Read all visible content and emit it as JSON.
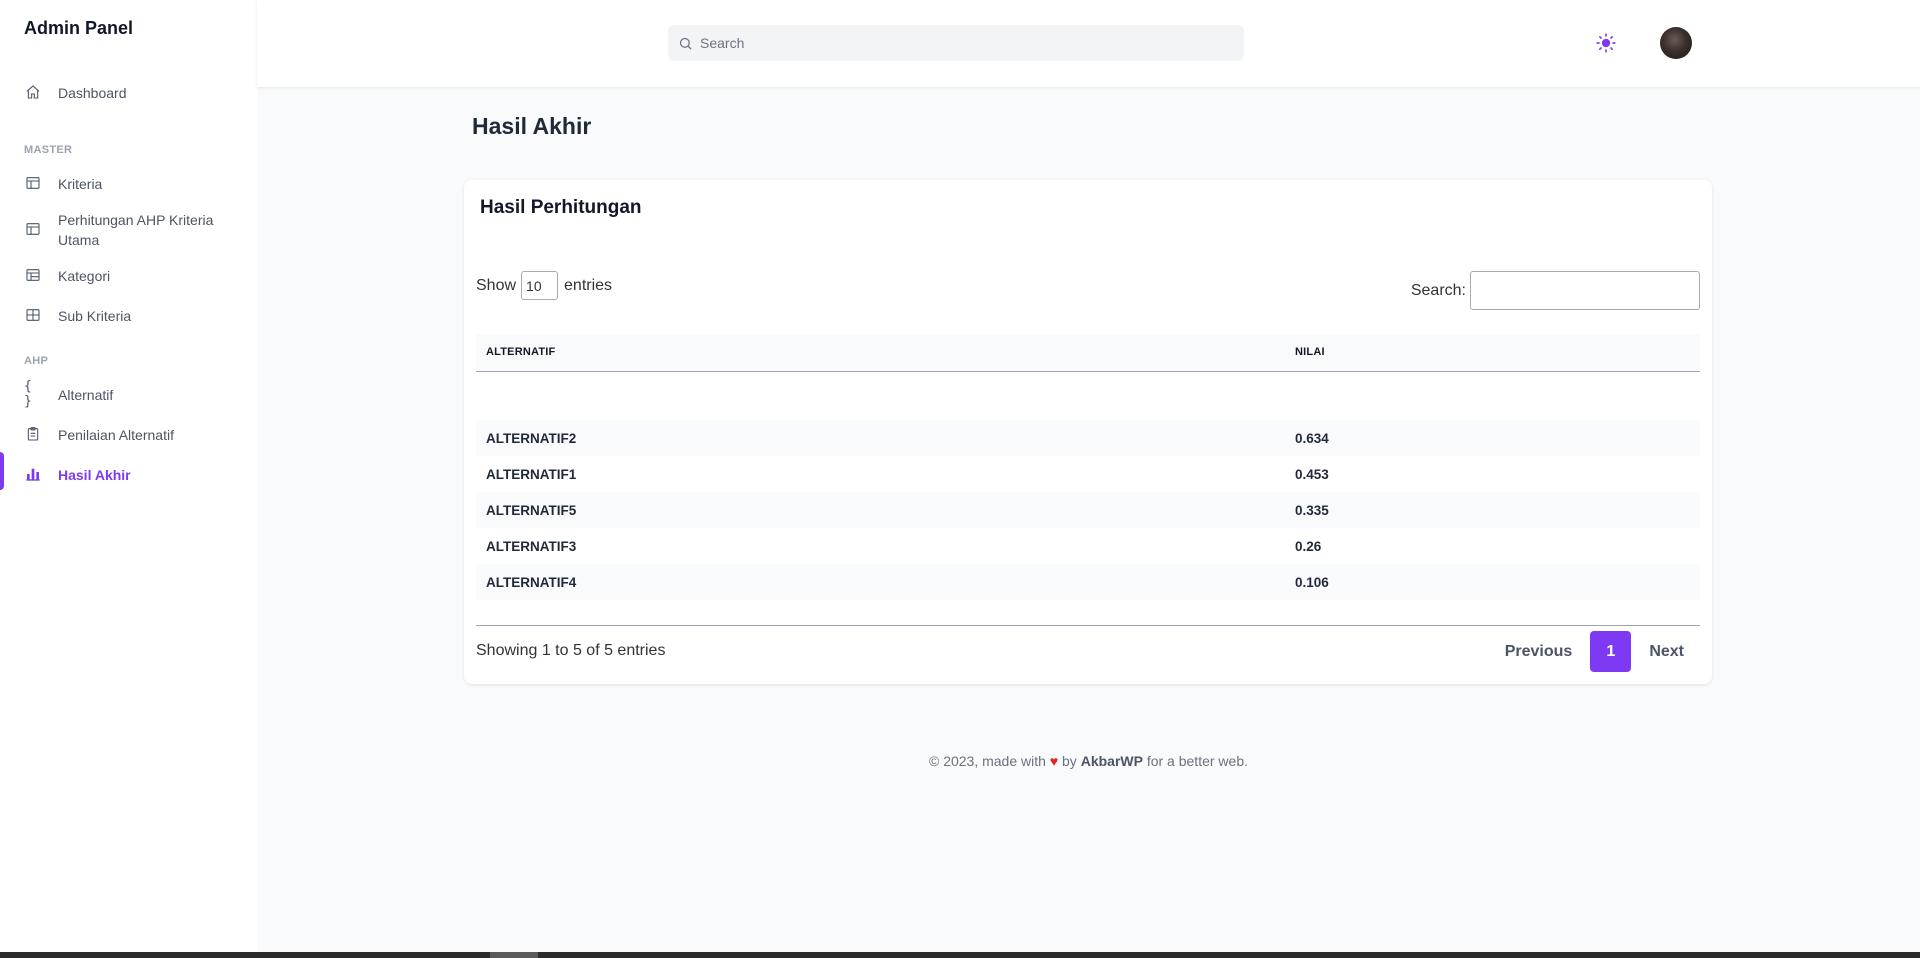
{
  "sidebar": {
    "brand": "Admin Panel",
    "dashboard": "Dashboard",
    "section_master": "MASTER",
    "kriteria": "Kriteria",
    "ahp_line1": "Perhitungan AHP Kriteria",
    "ahp_line2": "Utama",
    "kategori": "Kategori",
    "sub_kriteria": "Sub Kriteria",
    "section_ahp": "AHP",
    "alternatif": "Alternatif",
    "penilaian": "Penilaian Alternatif",
    "hasil": "Hasil Akhir",
    "active_color": "#7e3af2"
  },
  "header": {
    "search_placeholder": "Search"
  },
  "page": {
    "title": "Hasil Akhir"
  },
  "card": {
    "title": "Hasil Perhitungan",
    "show_label": "Show",
    "page_length": "10",
    "entries_label": "entries",
    "search_label": "Search:",
    "columns": [
      "ALTERNATIF",
      "NILAI"
    ],
    "rows": [
      {
        "alternatif": "ALTERNATIF2",
        "nilai": "0.634"
      },
      {
        "alternatif": "ALTERNATIF1",
        "nilai": "0.453"
      },
      {
        "alternatif": "ALTERNATIF5",
        "nilai": "0.335"
      },
      {
        "alternatif": "ALTERNATIF3",
        "nilai": "0.26"
      },
      {
        "alternatif": "ALTERNATIF4",
        "nilai": "0.106"
      }
    ],
    "info": "Showing 1 to 5 of 5 entries",
    "prev": "Previous",
    "page": "1",
    "next": "Next"
  },
  "footer": {
    "prefix": "© 2023, made with",
    "by": "by",
    "author": "AkbarWP",
    "suffix": "for a better web."
  }
}
